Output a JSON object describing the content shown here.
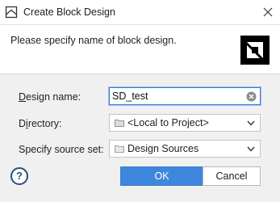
{
  "window": {
    "title": "Create Block Design",
    "icon": "block-design-icon"
  },
  "header": {
    "message": "Please specify name of block design.",
    "logo": "amd-logo"
  },
  "form": {
    "design_name": {
      "label_underline": "D",
      "label_rest": "esign name:",
      "value": "SD_test"
    },
    "directory": {
      "label_pre": "D",
      "label_underline": "i",
      "label_rest": "rectory:",
      "value": "<Local to Project>"
    },
    "source_set": {
      "label": "Specify source set:",
      "value": "Design Sources"
    }
  },
  "buttons": {
    "help": "?",
    "ok": "OK",
    "cancel": "Cancel"
  }
}
